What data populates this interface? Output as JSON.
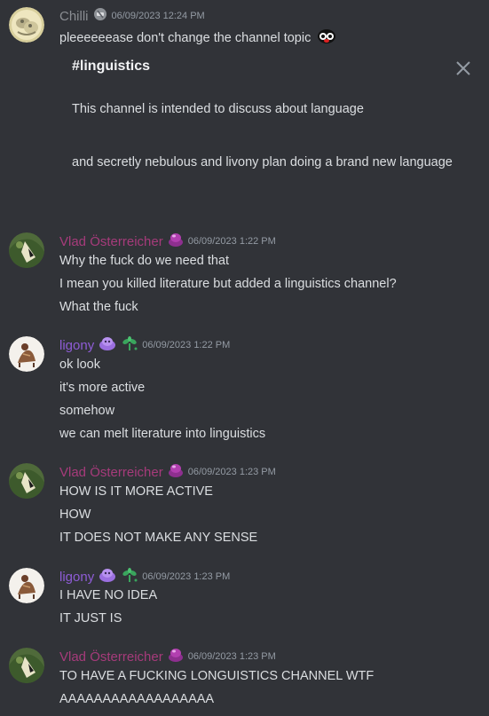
{
  "messages": [
    {
      "username": "Chilli",
      "username_color": "#8a8d92",
      "timestamp": "06/09/2023 12:24 PM",
      "lines": [
        "pleeeeeease don't change the channel topic"
      ],
      "badges": [
        "wrench-badge-icon"
      ],
      "trailing_emoji": "panda-emoji-icon"
    },
    {
      "username": "Vlad Österreicher",
      "username_color": "#a63b7b",
      "timestamp": "06/09/2023 1:22 PM",
      "lines": [
        "Why the fuck do we need that",
        "I mean you killed literature but added a linguistics channel?",
        "What the fuck"
      ],
      "badges": [
        "purple-blob-icon"
      ]
    },
    {
      "username": "ligony",
      "username_color": "#8e5cd6",
      "timestamp": "06/09/2023 1:22 PM",
      "lines": [
        "ok look",
        "it's more active",
        "somehow",
        "we can melt literature into linguistics"
      ],
      "badges": [
        "purple-creature-icon",
        "green-sprout-icon"
      ]
    },
    {
      "username": "Vlad Österreicher",
      "username_color": "#a63b7b",
      "timestamp": "06/09/2023 1:23 PM",
      "lines": [
        "HOW IS IT MORE ACTIVE",
        "HOW",
        "IT DOES NOT MAKE ANY SENSE"
      ],
      "badges": [
        "purple-blob-icon"
      ]
    },
    {
      "username": "ligony",
      "username_color": "#8e5cd6",
      "timestamp": "06/09/2023 1:23 PM",
      "lines": [
        "I HAVE NO IDEA",
        "IT JUST IS"
      ],
      "badges": [
        "purple-creature-icon",
        "green-sprout-icon"
      ]
    },
    {
      "username": "Vlad Österreicher",
      "username_color": "#a63b7b",
      "timestamp": "06/09/2023 1:23 PM",
      "lines": [
        "TO HAVE A FUCKING LONGUISTICS CHANNEL WTF",
        "AAAAAAAAAAAAAAAAAA"
      ],
      "badges": [
        "purple-blob-icon"
      ]
    }
  ],
  "embed": {
    "title": "#linguistics",
    "description_line1": "This channel is intended to discuss about language",
    "description_line2": "and secretly nebulous and livony plan doing a brand new language",
    "close_icon": "close-icon"
  },
  "colors": {
    "background": "#313338",
    "text": "#dbdee1",
    "muted": "#949ba4"
  }
}
